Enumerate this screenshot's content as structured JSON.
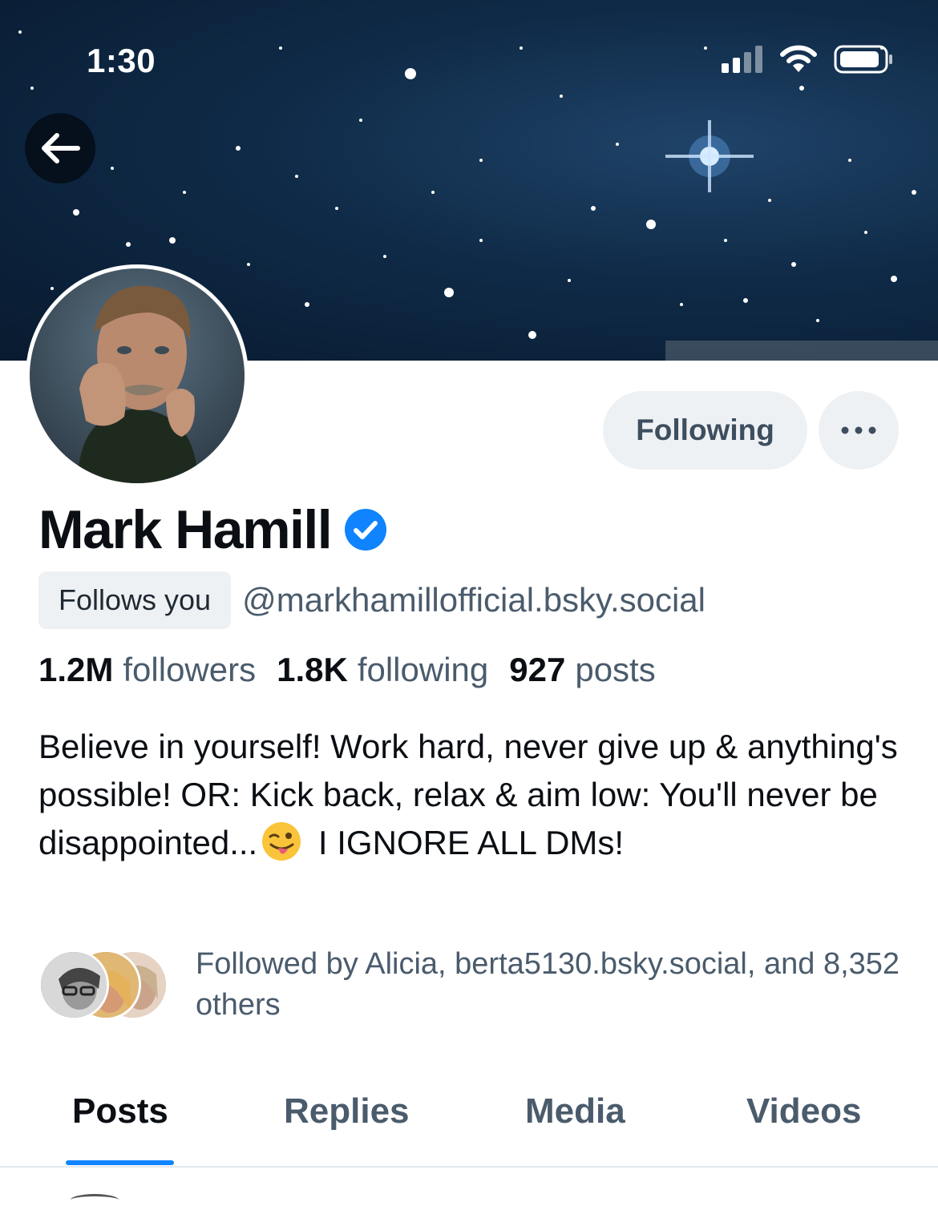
{
  "status_bar": {
    "time": "1:30",
    "icons": [
      "signal-icon",
      "wifi-icon",
      "battery-icon"
    ]
  },
  "header": {
    "back_icon": "arrow-left-icon"
  },
  "profile": {
    "display_name": "Mark Hamill",
    "verified_icon": "verified-check-icon",
    "follows_you_label": "Follows you",
    "handle": "@markhamillofficial.bsky.social",
    "following_button_label": "Following",
    "more_icon": "ellipsis-icon"
  },
  "stats": {
    "followers_count": "1.2M",
    "followers_label": "followers",
    "following_count": "1.8K",
    "following_label": "following",
    "posts_count": "927",
    "posts_label": "posts"
  },
  "bio": {
    "part1": "Believe in yourself! Work hard, never give up & anything's possible! OR: Kick back, relax & aim low: You'll never be disappointed...",
    "emoji": "winking-face-with-tongue",
    "part2": " I IGNORE ALL DMs!"
  },
  "followed_by": {
    "text": "Followed by Alicia, berta5130.bsky.social, and 8,352 others"
  },
  "tabs": [
    {
      "label": "Posts",
      "active": true
    },
    {
      "label": "Replies",
      "active": false
    },
    {
      "label": "Media",
      "active": false
    },
    {
      "label": "Videos",
      "active": false
    }
  ],
  "colors": {
    "accent": "#1083fe",
    "muted_text": "#4a5b6c",
    "pill_bg": "#eef1f4"
  }
}
